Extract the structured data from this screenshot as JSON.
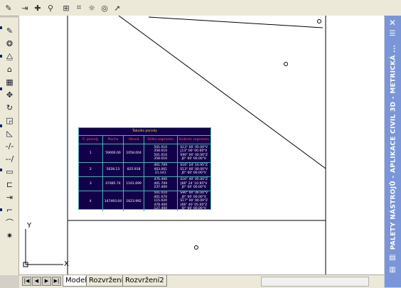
{
  "top_toolbar": {
    "icons": [
      "properties-icon",
      "layer-icon",
      "node-icon",
      "ucs-icon",
      "grid-icon",
      "snap-icon",
      "render-icon",
      "orbit-icon"
    ]
  },
  "left_toolbar": {
    "icons": [
      "pencil-icon",
      "copy-icon",
      "mirror-icon",
      "offset-icon",
      "array-icon",
      "move-icon",
      "rotate-icon",
      "scale-icon",
      "stretch-icon",
      "trim-icon",
      "extend-icon",
      "break-icon",
      "join-icon",
      "chamfer-icon",
      "fillet-icon",
      "explode-icon"
    ]
  },
  "table": {
    "title": "Tabulka parcely",
    "headers": [
      "Č. parcely",
      "Plocha",
      "Obvod",
      "Délka segmentu",
      "Směrník segmentu"
    ],
    "rows": [
      {
        "id": "1",
        "area": "59000.00",
        "perimeter": "1058.004",
        "lengths": [
          "501.010",
          "358.010",
          "501.010",
          "358.010"
        ],
        "bearings": [
          "S13° 00' 05.00\"V",
          "J13° 00' 00.00\"V",
          "S90° 00' 00.00\"Z",
          "J0° 00' 00.00\"V"
        ]
      },
      {
        "id": "2",
        "area": "5028.13",
        "perimeter": "825.918",
        "lengths": [
          "401.709",
          "403.001",
          "21.141"
        ],
        "bearings": [
          "S16° 24' 10.95\"Z",
          "S13° 00' 00.00\"V",
          "J0° 00' 00.00\"V"
        ]
      },
      {
        "id": "3",
        "area": "47485.74",
        "perimeter": "1161.699",
        "lengths": [
          "476.400",
          "401.709",
          "237.400"
        ],
        "bearings": [
          "S16° 40' 05.00\"Z",
          "J66° 24' 10.95\"V",
          "J0° 00' 00.00\"V"
        ]
      },
      {
        "id": "4",
        "area": "147493.04",
        "perimeter": "1623.992",
        "lengths": [
          "501.010",
          "401.070",
          "115.020",
          "478.400",
          "127.400"
        ],
        "bearings": [
          "S90° 00' 00.00\"V",
          "J0° 00' 00.00\"V",
          "S17° 00' 00.00\"Z",
          "J66° 40' 05.00\"Z",
          "J0° 00' 00.00\"V"
        ]
      }
    ]
  },
  "ucs": {
    "y_label": "Y",
    "x_label": "X"
  },
  "tabs": [
    {
      "label": "Model",
      "active": true
    },
    {
      "label": "Rozvržení1",
      "active": false
    },
    {
      "label": "Rozvržení2",
      "active": false
    }
  ],
  "palette": {
    "title": "PALETY NÁSTROJŮ - APLIKACE CIVIL 3D - METRICKÁ ..."
  }
}
